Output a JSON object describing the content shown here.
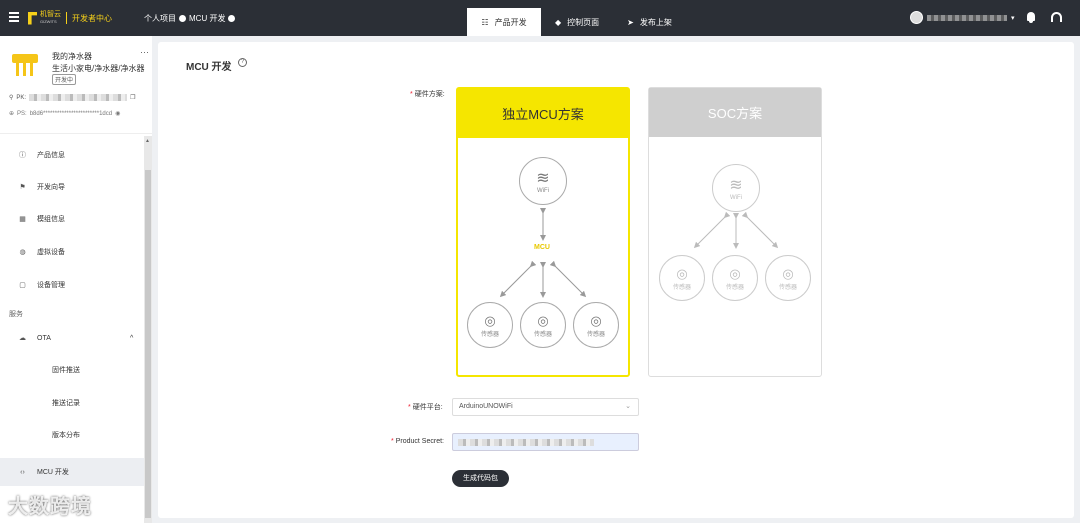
{
  "topbar": {
    "logo_text": "机智云",
    "logo_small": "GIZWITS",
    "dev_center": "开发者中心",
    "crumb_project": "个人项目",
    "crumb_page": "MCU 开发",
    "tabs": [
      {
        "label": "产品开发",
        "icon": "grid-icon"
      },
      {
        "label": "控制页面",
        "icon": "diamond-icon"
      },
      {
        "label": "发布上架",
        "icon": "send-icon"
      }
    ]
  },
  "product": {
    "name": "我的净水器",
    "category": "生活小家电/净水器/净水器",
    "badge": "开发中",
    "more": "···",
    "pk_label": "PK:",
    "ps_label": "PS:",
    "ps_value": "b8d6************************1dcd"
  },
  "nav": {
    "items": [
      {
        "label": "产品信息",
        "icon": "info-icon"
      },
      {
        "label": "开发向导",
        "icon": "guide-icon"
      },
      {
        "label": "模组信息",
        "icon": "module-icon"
      },
      {
        "label": "虚拟设备",
        "icon": "virtual-device-icon"
      },
      {
        "label": "设备管理",
        "icon": "device-icon"
      }
    ],
    "group_label": "服务",
    "ota_label": "OTA",
    "ota_sub": [
      "固件推送",
      "推送记录",
      "版本分布"
    ],
    "mcu_dev": "MCU 开发"
  },
  "watermark": "大数跨境",
  "main": {
    "title": "MCU 开发",
    "hw_scheme_label": "硬件方案:",
    "mcu_card_title": "独立MCU方案",
    "soc_card_title": "SOC方案",
    "wifi_label": "WiFi",
    "mcu_label": "MCU",
    "sensor_label": "传感器",
    "hw_platform_label": "硬件平台:",
    "hw_platform_value": "ArduinoUNOWiFi",
    "product_secret_label": "Product Secret:",
    "generate_button": "生成代码包"
  },
  "colors": {
    "accent": "#f5e600",
    "topbar": "#2b2f36",
    "required": "#ee2233"
  }
}
